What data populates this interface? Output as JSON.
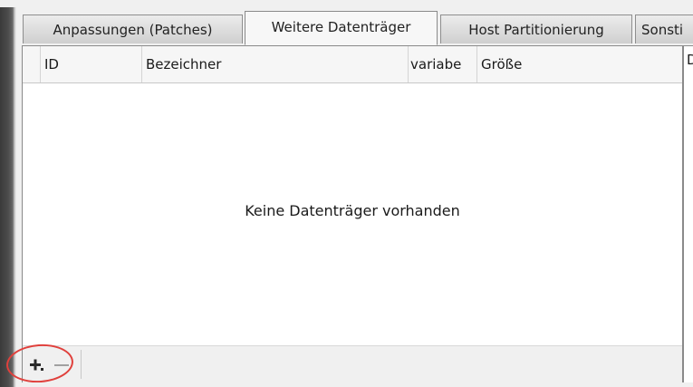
{
  "tabs": [
    {
      "label": "Anpassungen (Patches)",
      "active": false
    },
    {
      "label": "Weitere Datenträger",
      "active": true
    },
    {
      "label": "Host Partitionierung",
      "active": false
    },
    {
      "label": "Sonsti",
      "active": false
    }
  ],
  "table": {
    "columns": [
      "",
      "ID",
      "Bezeichner",
      "variabe",
      "Größe"
    ],
    "rows": [],
    "empty_message": "Keine Datenträger vorhanden"
  },
  "toolbar": {
    "add_icon": "plus-icon",
    "remove_icon": "minus-icon"
  },
  "right_panel": {
    "label": "D"
  },
  "colors": {
    "annotation": "#e0403c",
    "tab_active_bg": "#f7f7f7",
    "pane_bg": "#ffffff"
  }
}
